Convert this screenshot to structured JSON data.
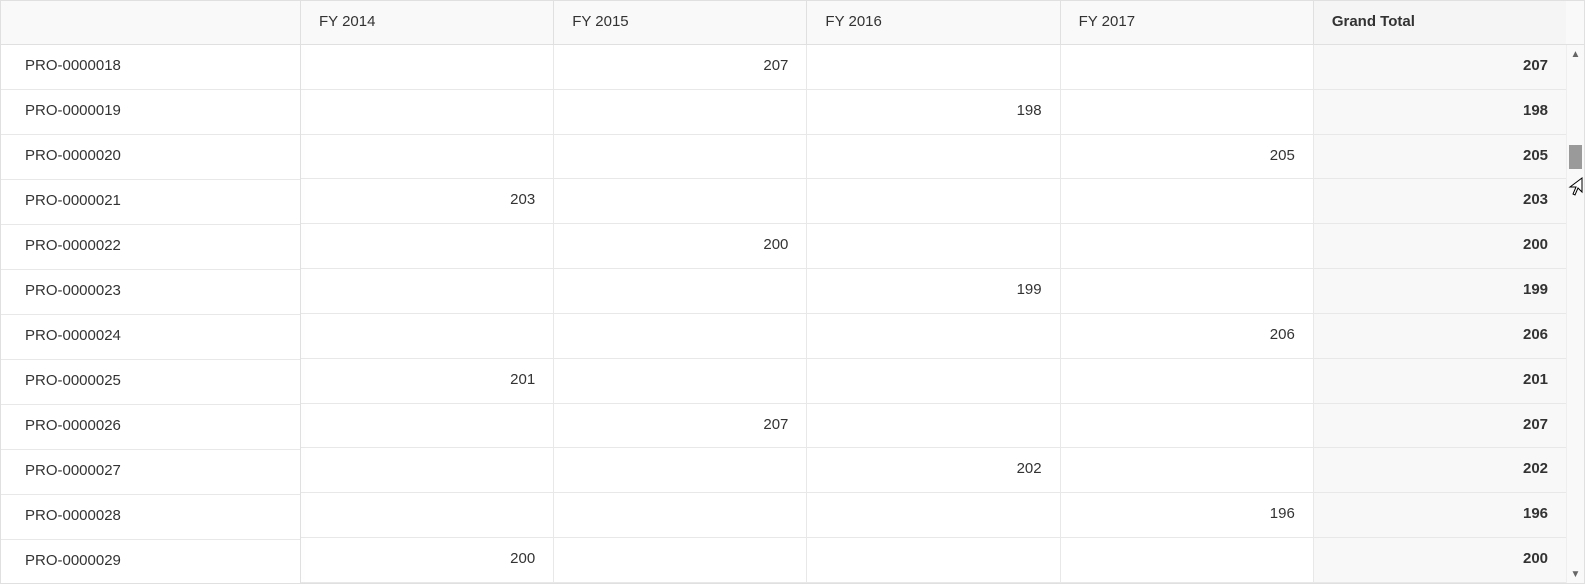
{
  "columns": [
    "FY 2014",
    "FY 2015",
    "FY 2016",
    "FY 2017",
    "Grand Total"
  ],
  "rows": [
    {
      "label": "PRO-0000018",
      "fy2014": "",
      "fy2015": "207",
      "fy2016": "",
      "fy2017": "",
      "total": "207"
    },
    {
      "label": "PRO-0000019",
      "fy2014": "",
      "fy2015": "",
      "fy2016": "198",
      "fy2017": "",
      "total": "198"
    },
    {
      "label": "PRO-0000020",
      "fy2014": "",
      "fy2015": "",
      "fy2016": "",
      "fy2017": "205",
      "total": "205"
    },
    {
      "label": "PRO-0000021",
      "fy2014": "203",
      "fy2015": "",
      "fy2016": "",
      "fy2017": "",
      "total": "203"
    },
    {
      "label": "PRO-0000022",
      "fy2014": "",
      "fy2015": "200",
      "fy2016": "",
      "fy2017": "",
      "total": "200"
    },
    {
      "label": "PRO-0000023",
      "fy2014": "",
      "fy2015": "",
      "fy2016": "199",
      "fy2017": "",
      "total": "199"
    },
    {
      "label": "PRO-0000024",
      "fy2014": "",
      "fy2015": "",
      "fy2016": "",
      "fy2017": "206",
      "total": "206"
    },
    {
      "label": "PRO-0000025",
      "fy2014": "201",
      "fy2015": "",
      "fy2016": "",
      "fy2017": "",
      "total": "201"
    },
    {
      "label": "PRO-0000026",
      "fy2014": "",
      "fy2015": "207",
      "fy2016": "",
      "fy2017": "",
      "total": "207"
    },
    {
      "label": "PRO-0000027",
      "fy2014": "",
      "fy2015": "",
      "fy2016": "202",
      "fy2017": "",
      "total": "202"
    },
    {
      "label": "PRO-0000028",
      "fy2014": "",
      "fy2015": "",
      "fy2016": "",
      "fy2017": "196",
      "total": "196"
    },
    {
      "label": "PRO-0000029",
      "fy2014": "200",
      "fy2015": "",
      "fy2016": "",
      "fy2017": "",
      "total": "200"
    }
  ]
}
